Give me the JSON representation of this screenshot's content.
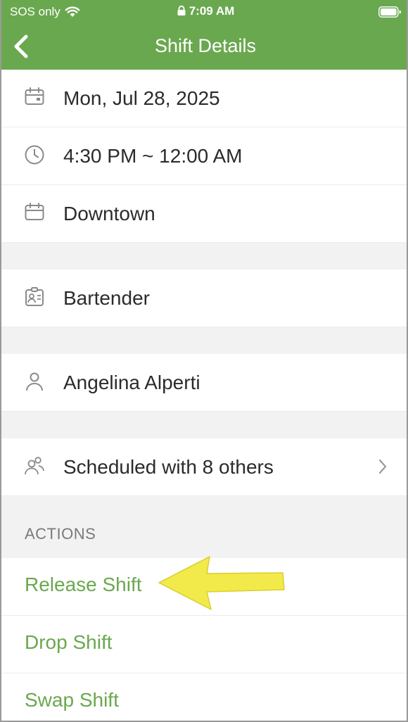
{
  "status_bar": {
    "carrier": "SOS only",
    "time": "7:09 AM"
  },
  "header": {
    "title": "Shift Details",
    "back_icon": "chevron-left-icon"
  },
  "shift": {
    "date": "Mon, Jul 28, 2025",
    "time_range": "4:30 PM ~ 12:00 AM",
    "location": "Downtown",
    "position": "Bartender",
    "employee": "Angelina Alperti",
    "coworkers": "Scheduled with 8 others"
  },
  "actions": {
    "section_label": "ACTIONS",
    "items": [
      "Release Shift",
      "Drop Shift",
      "Swap Shift"
    ]
  },
  "colors": {
    "brand": "#6aa84f",
    "annotation_arrow": "#f2ea4a"
  }
}
